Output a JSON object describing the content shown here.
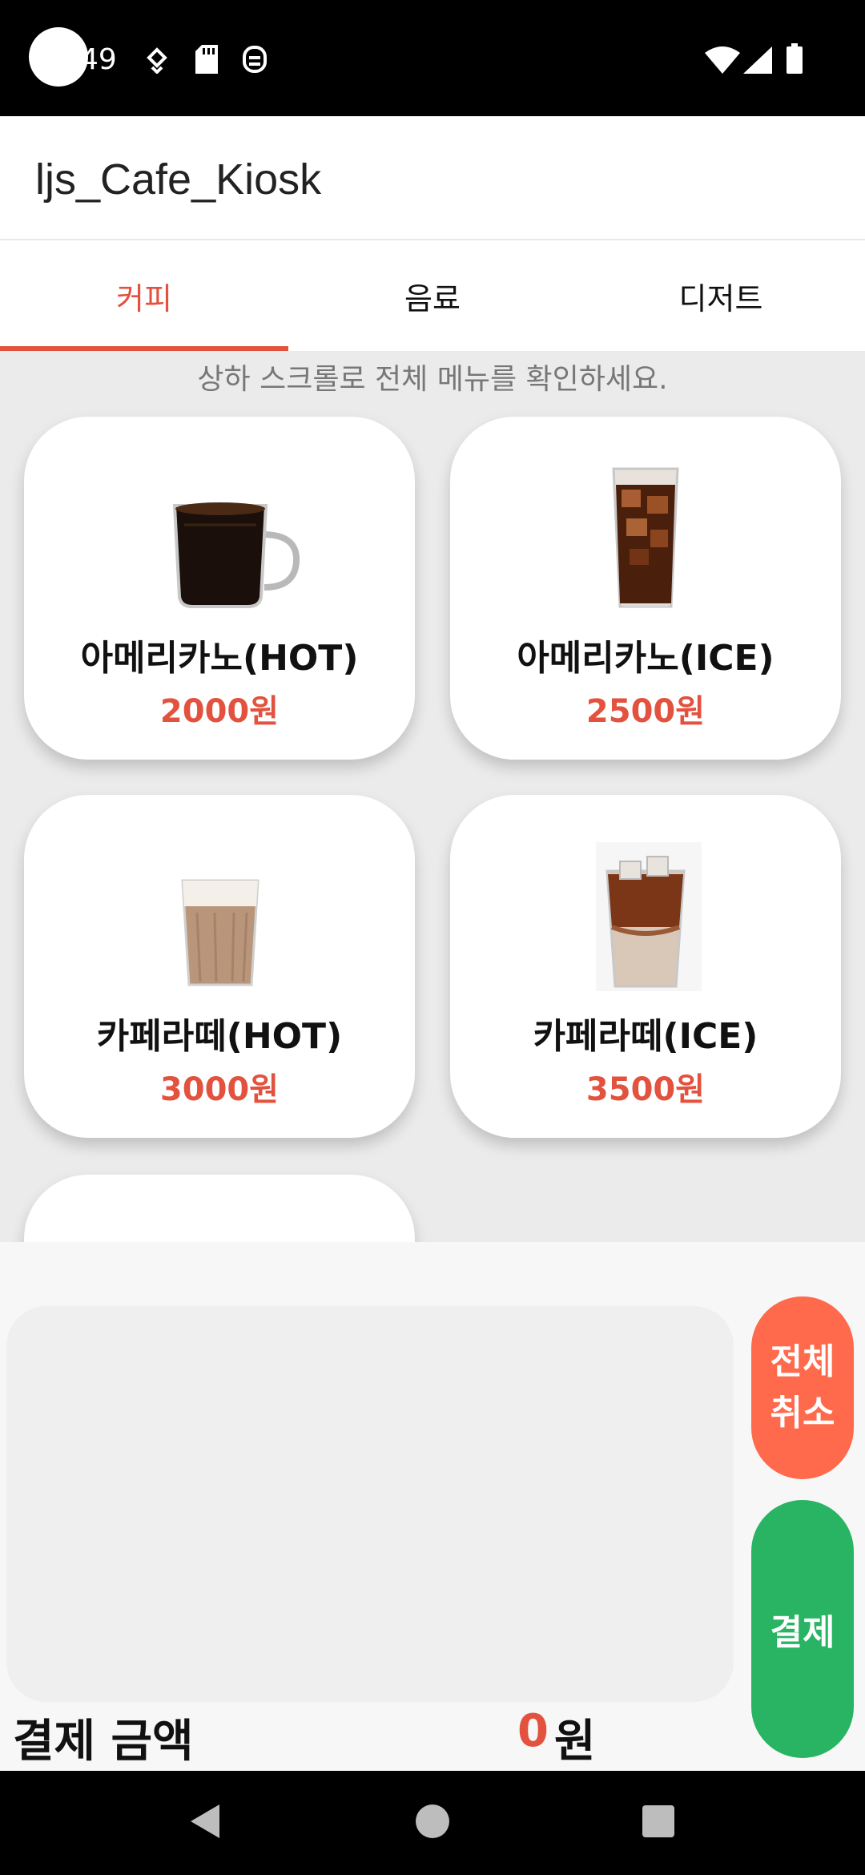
{
  "status_bar": {
    "time": "49"
  },
  "app_bar": {
    "title": "ljs_Cafe_Kiosk"
  },
  "tabs": [
    {
      "label": "커피",
      "active": true
    },
    {
      "label": "음료",
      "active": false
    },
    {
      "label": "디저트",
      "active": false
    }
  ],
  "menu": {
    "hint": "상하 스크롤로 전체 메뉴를 확인하세요.",
    "items": [
      {
        "name": "아메리카노(HOT)",
        "price": "2000원"
      },
      {
        "name": "아메리카노(ICE)",
        "price": "2500원"
      },
      {
        "name": "카페라떼(HOT)",
        "price": "3000원"
      },
      {
        "name": "카페라떼(ICE)",
        "price": "3500원"
      }
    ]
  },
  "order": {
    "cancel_all_label": "전체 취소",
    "pay_label": "결제",
    "total_label": "결제 금액",
    "total_value": "0",
    "total_unit": "원"
  },
  "colors": {
    "accent": "#e2523e",
    "cancel": "#ff6a4d",
    "pay": "#28b463"
  }
}
